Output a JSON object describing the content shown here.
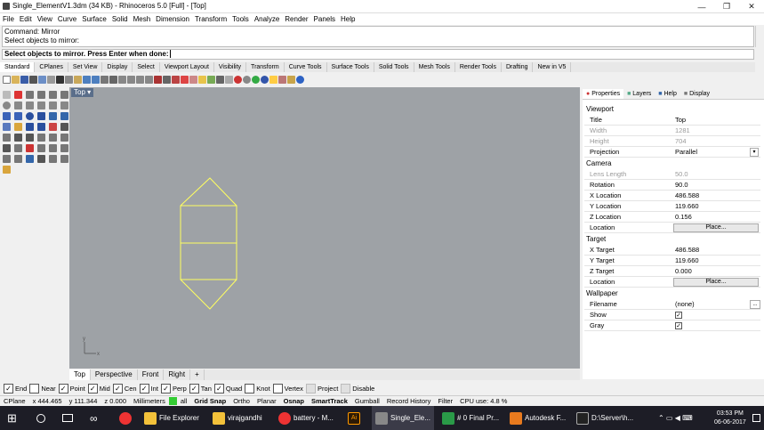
{
  "window": {
    "title": "Single_ElementV1.3dm (34 KB) - Rhinoceros 5.0 [Full] - [Top]",
    "min": "—",
    "max": "❐",
    "close": "✕"
  },
  "menu": [
    "File",
    "Edit",
    "View",
    "Curve",
    "Surface",
    "Solid",
    "Mesh",
    "Dimension",
    "Transform",
    "Tools",
    "Analyze",
    "Render",
    "Panels",
    "Help"
  ],
  "command": {
    "history_line1": "Command: Mirror",
    "history_line2": "Select objects to mirror:",
    "prompt": "Select objects to mirror. Press Enter when done:"
  },
  "toolbar_tabs": [
    "Standard",
    "CPlanes",
    "Set View",
    "Display",
    "Select",
    "Viewport Layout",
    "Visibility",
    "Transform",
    "Curve Tools",
    "Surface Tools",
    "Solid Tools",
    "Mesh Tools",
    "Render Tools",
    "Drafting",
    "New in V5"
  ],
  "viewport": {
    "name": "Top",
    "dropdown": "▾",
    "tabs": [
      "Top",
      "Perspective",
      "Front",
      "Right"
    ],
    "add_tab": "+",
    "axis_x": "x",
    "axis_y": "y"
  },
  "panel": {
    "tabs": [
      "Properties",
      "Layers",
      "Help",
      "Display"
    ],
    "viewport_section": "Viewport",
    "title_label": "Title",
    "title_value": "Top",
    "width_label": "Width",
    "width_value": "1281",
    "height_label": "Height",
    "height_value": "704",
    "projection_label": "Projection",
    "projection_value": "Parallel",
    "camera_section": "Camera",
    "lens_label": "Lens Length",
    "lens_value": "50.0",
    "rotation_label": "Rotation",
    "rotation_value": "90.0",
    "xloc_label": "X Location",
    "xloc_value": "486.588",
    "yloc_label": "Y Location",
    "yloc_value": "119.660",
    "zloc_label": "Z Location",
    "zloc_value": "0.156",
    "location_label": "Location",
    "place_button": "Place...",
    "target_section": "Target",
    "xt_label": "X Target",
    "xt_value": "486.588",
    "yt_label": "Y Target",
    "yt_value": "119.660",
    "zt_label": "Z Target",
    "zt_value": "0.000",
    "tlocation_label": "Location",
    "tplace_button": "Place...",
    "wallpaper_section": "Wallpaper",
    "filename_label": "Filename",
    "filename_value": "(none)",
    "filename_btn": "...",
    "show_label": "Show",
    "gray_label": "Gray",
    "check": "✓"
  },
  "osnaps": [
    {
      "label": "End",
      "on": true
    },
    {
      "label": "Near",
      "on": false
    },
    {
      "label": "Point",
      "on": true
    },
    {
      "label": "Mid",
      "on": true
    },
    {
      "label": "Cen",
      "on": true
    },
    {
      "label": "Int",
      "on": true
    },
    {
      "label": "Perp",
      "on": true
    },
    {
      "label": "Tan",
      "on": true
    },
    {
      "label": "Quad",
      "on": true
    },
    {
      "label": "Knot",
      "on": false
    },
    {
      "label": "Vertex",
      "on": false
    },
    {
      "label": "Project",
      "on": false
    },
    {
      "label": "Disable",
      "on": false
    }
  ],
  "status": {
    "cplane": "CPlane",
    "x": "x 444.465",
    "y": "y 111.344",
    "z": "z 0.000",
    "units": "Millimeters",
    "layer": "all",
    "gridsnap": "Grid Snap",
    "ortho": "Ortho",
    "planar": "Planar",
    "osnap": "Osnap",
    "smarttrack": "SmartTrack",
    "gumball": "Gumball",
    "record": "Record History",
    "filter": "Filter",
    "cpu": "CPU use: 4.8 %"
  },
  "taskbar": {
    "items": [
      "File Explorer",
      "virajgandhi",
      "battery - M...",
      "Single_Ele...",
      "# 0 Final Pr...",
      "Autodesk F...",
      "D:\\Server\\h..."
    ],
    "time": "03:53 PM",
    "date": "06-06-2017"
  },
  "colors": {
    "viewport_bg": "#9ea2a6",
    "curve": "#ffff60",
    "taskbar": "#1d1d26"
  }
}
